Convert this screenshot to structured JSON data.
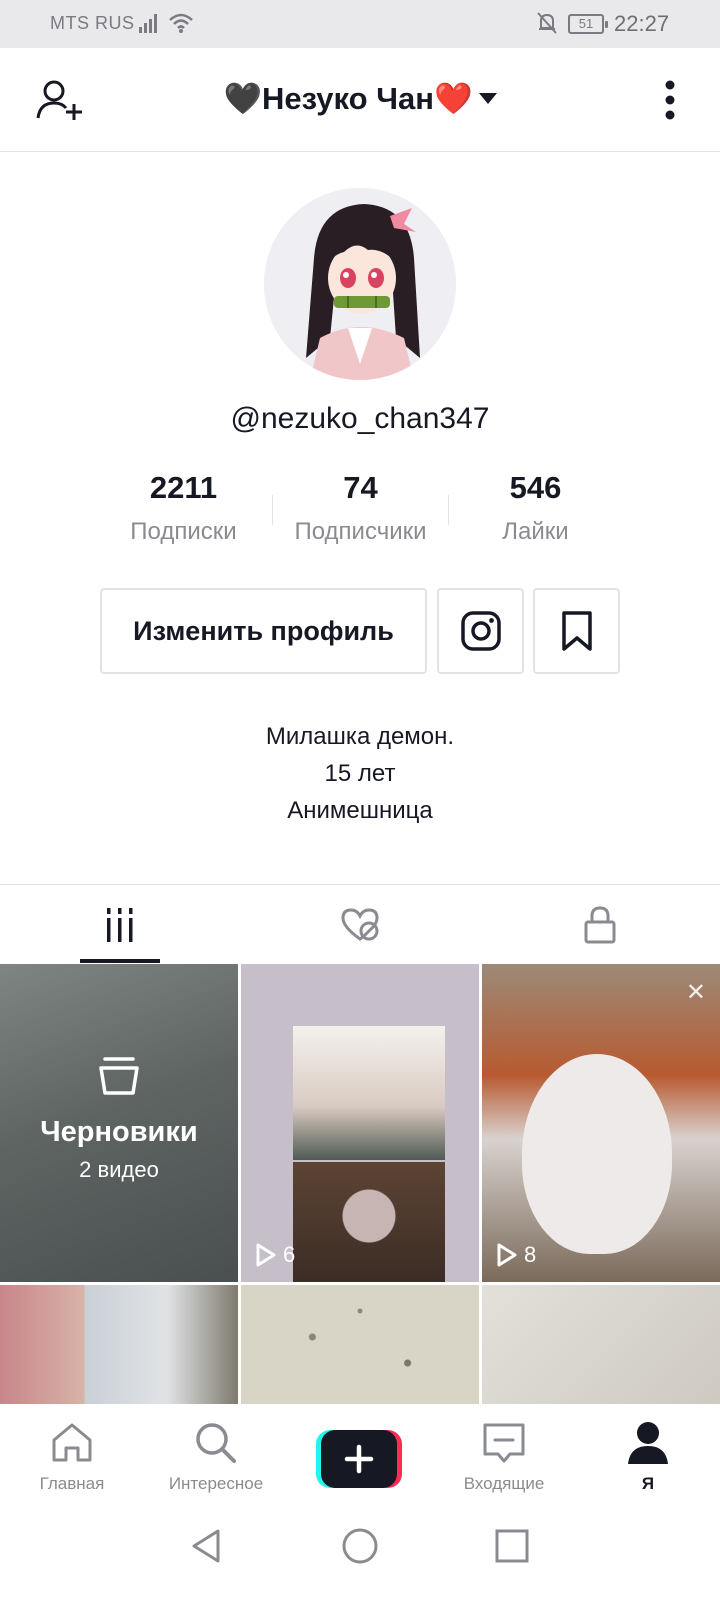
{
  "status_bar": {
    "carrier": "MTS RUS",
    "battery": "51",
    "time": "22:27"
  },
  "header": {
    "title": "🖤Незуко Чан❤️"
  },
  "profile": {
    "username": "@nezuko_chan347",
    "stats": [
      {
        "value": "2211",
        "label": "Подписки"
      },
      {
        "value": "74",
        "label": "Подписчики"
      },
      {
        "value": "546",
        "label": "Лайки"
      }
    ],
    "edit_button": "Изменить профиль",
    "bio": [
      "Милашка демон.",
      "15 лет",
      "Анимешница"
    ]
  },
  "grid": {
    "drafts_title": "Черновики",
    "drafts_count": "2 видео",
    "videos": [
      {
        "views": "6"
      },
      {
        "views": "8"
      }
    ]
  },
  "bottom_nav": {
    "home": "Главная",
    "discover": "Интересное",
    "inbox": "Входящие",
    "me": "Я"
  },
  "colors": {
    "text": "#161823",
    "muted": "#8a8b91",
    "border": "#e3e3e4",
    "create_cyan": "#25f4ee",
    "create_pink": "#fe2c55"
  }
}
